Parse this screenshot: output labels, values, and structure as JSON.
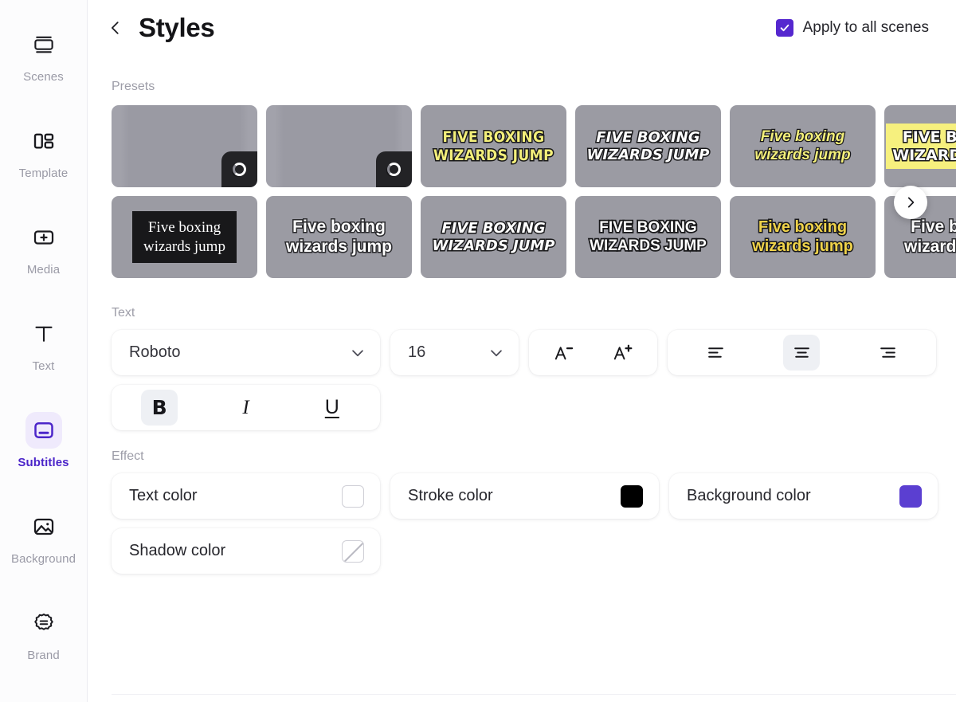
{
  "sidebar": {
    "items": [
      {
        "label": "Scenes",
        "icon": "scenes-icon",
        "active": false
      },
      {
        "label": "Template",
        "icon": "template-icon",
        "active": false
      },
      {
        "label": "Media",
        "icon": "media-plus-icon",
        "active": false
      },
      {
        "label": "Text",
        "icon": "text-t-icon",
        "active": false
      },
      {
        "label": "Subtitles",
        "icon": "subtitles-icon",
        "active": true
      },
      {
        "label": "Background",
        "icon": "background-image-icon",
        "active": false
      },
      {
        "label": "Brand",
        "icon": "brand-badge-icon",
        "active": false
      }
    ]
  },
  "header": {
    "back_icon": "chevron-left-icon",
    "title": "Styles",
    "apply_all_label": "Apply to all scenes",
    "apply_all_checked": true,
    "check_icon": "check-icon",
    "checkbox_color": "#5527CF"
  },
  "presets": {
    "label": "Presets",
    "next_icon": "chevron-right-icon",
    "tile_background": "#9B9BA3",
    "row1": [
      {
        "style": "skeleton",
        "text": "",
        "loading": true,
        "spinner_icon": "spinner-icon"
      },
      {
        "style": "skeleton",
        "text": "",
        "loading": true,
        "spinner_icon": "spinner-icon"
      },
      {
        "style": "yellow-condensed-outline",
        "text": "FIVE BOXING\nWIZARDS JUMP",
        "loading": false
      },
      {
        "style": "white-italic-outline",
        "text": "FIVE BOXING\nWIZARDS JUMP",
        "loading": false
      },
      {
        "style": "yellow-italic-outline",
        "text": "Five boxing\nwizards jump",
        "loading": false
      },
      {
        "style": "yellow-highlight",
        "text": "FIVE BOXING\nWIZARDS JUMP",
        "loading": false
      }
    ],
    "row2": [
      {
        "style": "serif-black-box",
        "text": "Five boxing\nwizards jump",
        "loading": false
      },
      {
        "style": "white-bold-outline",
        "text": "Five boxing\nwizards jump",
        "loading": false
      },
      {
        "style": "white-italic-caps-outline",
        "text": "FIVE BOXING\nWIZARDS JUMP",
        "loading": false
      },
      {
        "style": "white-caps-outline",
        "text": "FIVE BOXING\nWIZARDS JUMP",
        "loading": false
      },
      {
        "style": "gold-bold-outline",
        "text": "Five boxing\nwizards jump",
        "loading": false
      },
      {
        "style": "white-bold-outline",
        "text": "Five boxing\nwizards jump",
        "loading": false
      }
    ]
  },
  "text_section": {
    "label": "Text",
    "font_family": "Roboto",
    "font_family_chevron": "chevron-down-icon",
    "font_size": "16",
    "font_size_chevron": "chevron-down-icon",
    "decrease_font_icon": "decrease-font-size-icon",
    "increase_font_icon": "increase-font-size-icon",
    "align": {
      "left_icon": "align-left-icon",
      "center_icon": "align-center-icon",
      "right_icon": "align-right-icon",
      "selected": "center"
    },
    "style": {
      "bold_label": "B",
      "italic_label": "I",
      "underline_label": "U",
      "bold_active": true,
      "italic_active": false,
      "underline_active": false
    }
  },
  "effect_section": {
    "label": "Effect",
    "items": [
      {
        "label": "Text color",
        "color": "#FFFFFF",
        "swatch": "white"
      },
      {
        "label": "Stroke color",
        "color": "#000000",
        "swatch": "black"
      },
      {
        "label": "Background color",
        "color": "#5B3FD1",
        "swatch": "purple"
      },
      {
        "label": "Shadow color",
        "color": "none",
        "swatch": "none"
      }
    ]
  }
}
